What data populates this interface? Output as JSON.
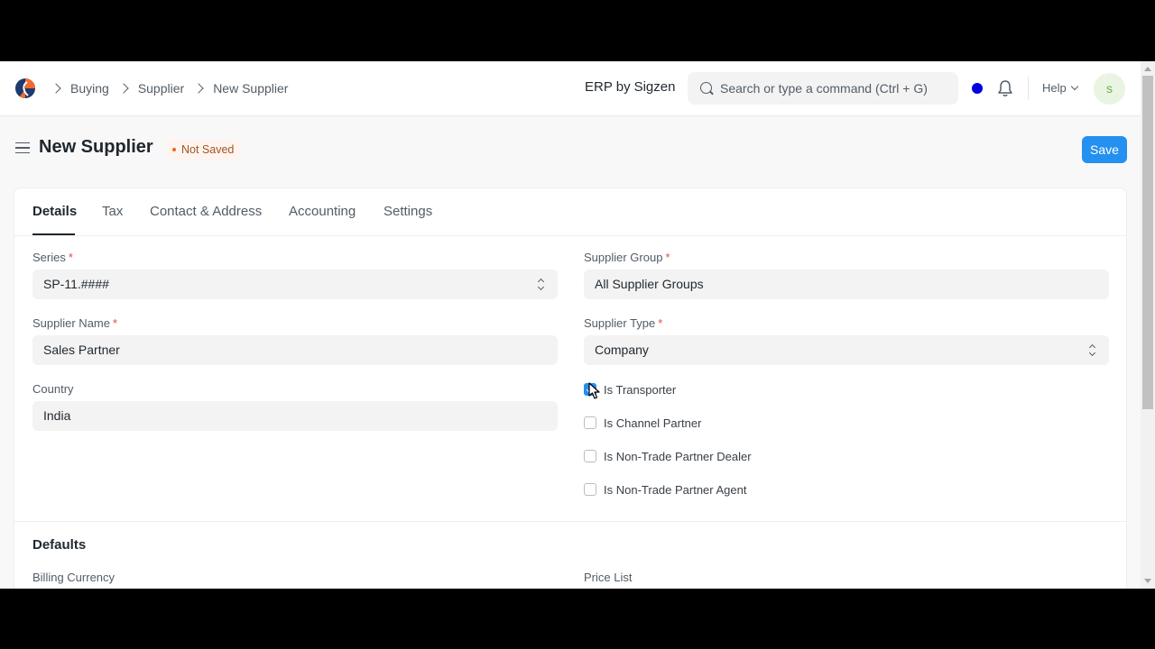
{
  "navbar": {
    "breadcrumbs": [
      "Buying",
      "Supplier",
      "New Supplier"
    ],
    "brand_prefix": "ERP by",
    "brand_name": "Sigzen",
    "search_placeholder": "Search or type a command (Ctrl + G)",
    "help_label": "Help",
    "avatar_initial": "s",
    "status_dot_color": "#0000e0"
  },
  "page": {
    "title": "New Supplier",
    "status": "Not Saved",
    "save_label": "Save"
  },
  "tabs": [
    "Details",
    "Tax",
    "Contact & Address",
    "Accounting",
    "Settings"
  ],
  "active_tab": "Details",
  "form": {
    "series": {
      "label": "Series",
      "value": "SP-11.####"
    },
    "supplier_name": {
      "label": "Supplier Name",
      "value": "Sales Partner"
    },
    "country": {
      "label": "Country",
      "value": "India"
    },
    "supplier_group": {
      "label": "Supplier Group",
      "value": "All Supplier Groups"
    },
    "supplier_type": {
      "label": "Supplier Type",
      "value": "Company"
    },
    "checkboxes": [
      {
        "label": "Is Transporter",
        "checked": true
      },
      {
        "label": "Is Channel Partner",
        "checked": false
      },
      {
        "label": "Is Non-Trade Partner Dealer",
        "checked": false
      },
      {
        "label": "Is Non-Trade Partner Agent",
        "checked": false
      }
    ]
  },
  "defaults": {
    "title": "Defaults",
    "billing_currency_label": "Billing Currency",
    "price_list_label": "Price List"
  },
  "colors": {
    "primary": "#2490ef",
    "required": "#e24c4c",
    "indicator_text": "#a1541f"
  }
}
